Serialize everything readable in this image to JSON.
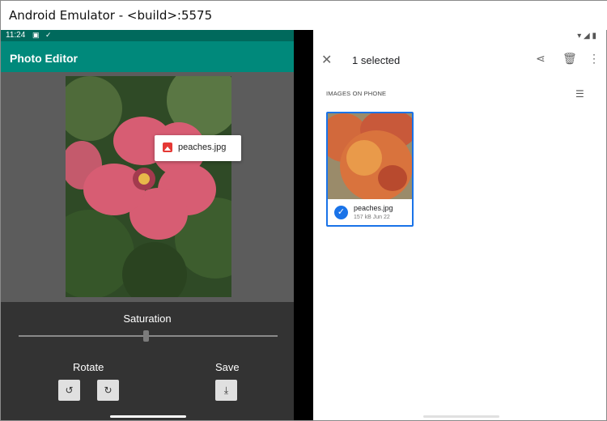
{
  "window": {
    "title": "Android Emulator - <build>:5575"
  },
  "left": {
    "status": {
      "time": "11:24"
    },
    "appbar_title": "Photo Editor",
    "attachment": {
      "filename": "peaches.jpg"
    },
    "controls": {
      "saturation_label": "Saturation",
      "saturation_value": 0.49,
      "rotate_label": "Rotate",
      "save_label": "Save"
    }
  },
  "right": {
    "selection": {
      "count_label": "1 selected"
    },
    "section_header": "IMAGES ON PHONE",
    "files": [
      {
        "name": "peaches.jpg",
        "meta": "157 kB Jun 22",
        "selected": true
      }
    ]
  },
  "colors": {
    "statusbar": "#00695c",
    "appbar": "#00897b",
    "selection": "#1a73e8"
  }
}
